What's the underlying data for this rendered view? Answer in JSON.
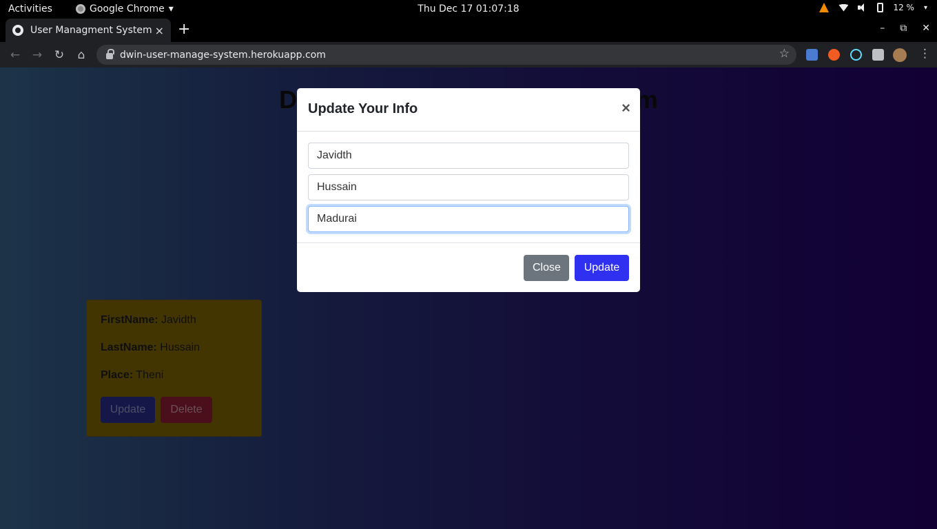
{
  "system": {
    "activities": "Activities",
    "app_name": "Google Chrome",
    "clock": "Thu Dec 17  01:07:18",
    "battery": "12 %"
  },
  "browser": {
    "tab_title": "User Managment System",
    "tab_close": "×",
    "new_tab": "+",
    "url": "dwin-user-manage-system.herokuapp.com",
    "window_controls": [
      "–",
      "⧉",
      "✕"
    ]
  },
  "page": {
    "heading": "DWin User Management System",
    "card": {
      "firstname_label": "FirstName:",
      "firstname_value": "Javidth",
      "lastname_label": "LastName:",
      "lastname_value": "Hussain",
      "place_label": "Place:",
      "place_value": "Theni",
      "update_label": "Update",
      "delete_label": "Delete"
    }
  },
  "modal": {
    "title": "Update Your Info",
    "close_icon": "×",
    "firstname": "Javidth",
    "lastname": "Hussain",
    "place": "Madurai",
    "close_label": "Close",
    "update_label": "Update"
  },
  "colors": {
    "modal_primary": "#3030f0",
    "modal_secondary": "#6c757d",
    "card_bg": "#876a03"
  }
}
